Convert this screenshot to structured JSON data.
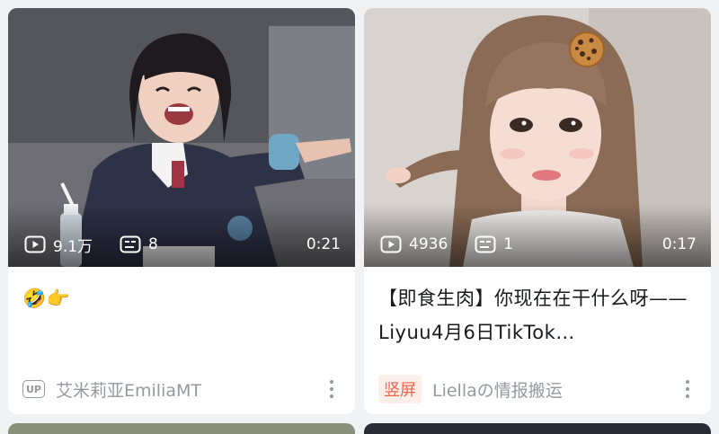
{
  "cards": [
    {
      "views": "9.1万",
      "comments": "8",
      "duration": "0:21",
      "title": "🤣👉",
      "badge": "UP",
      "author": "艾米莉亚EmiliaMT"
    },
    {
      "views": "4936",
      "comments": "1",
      "duration": "0:17",
      "title": "【即食生肉】你现在在干什么呀——Liyuu4月6日TikTok…",
      "tag": "竖屏",
      "author": "Liellaの情报搬运"
    }
  ],
  "icons": {
    "views": "play-count-icon",
    "comments": "danmaku-icon",
    "more": "more-vertical-icon",
    "sticker": "cookie-sticker-icon"
  }
}
